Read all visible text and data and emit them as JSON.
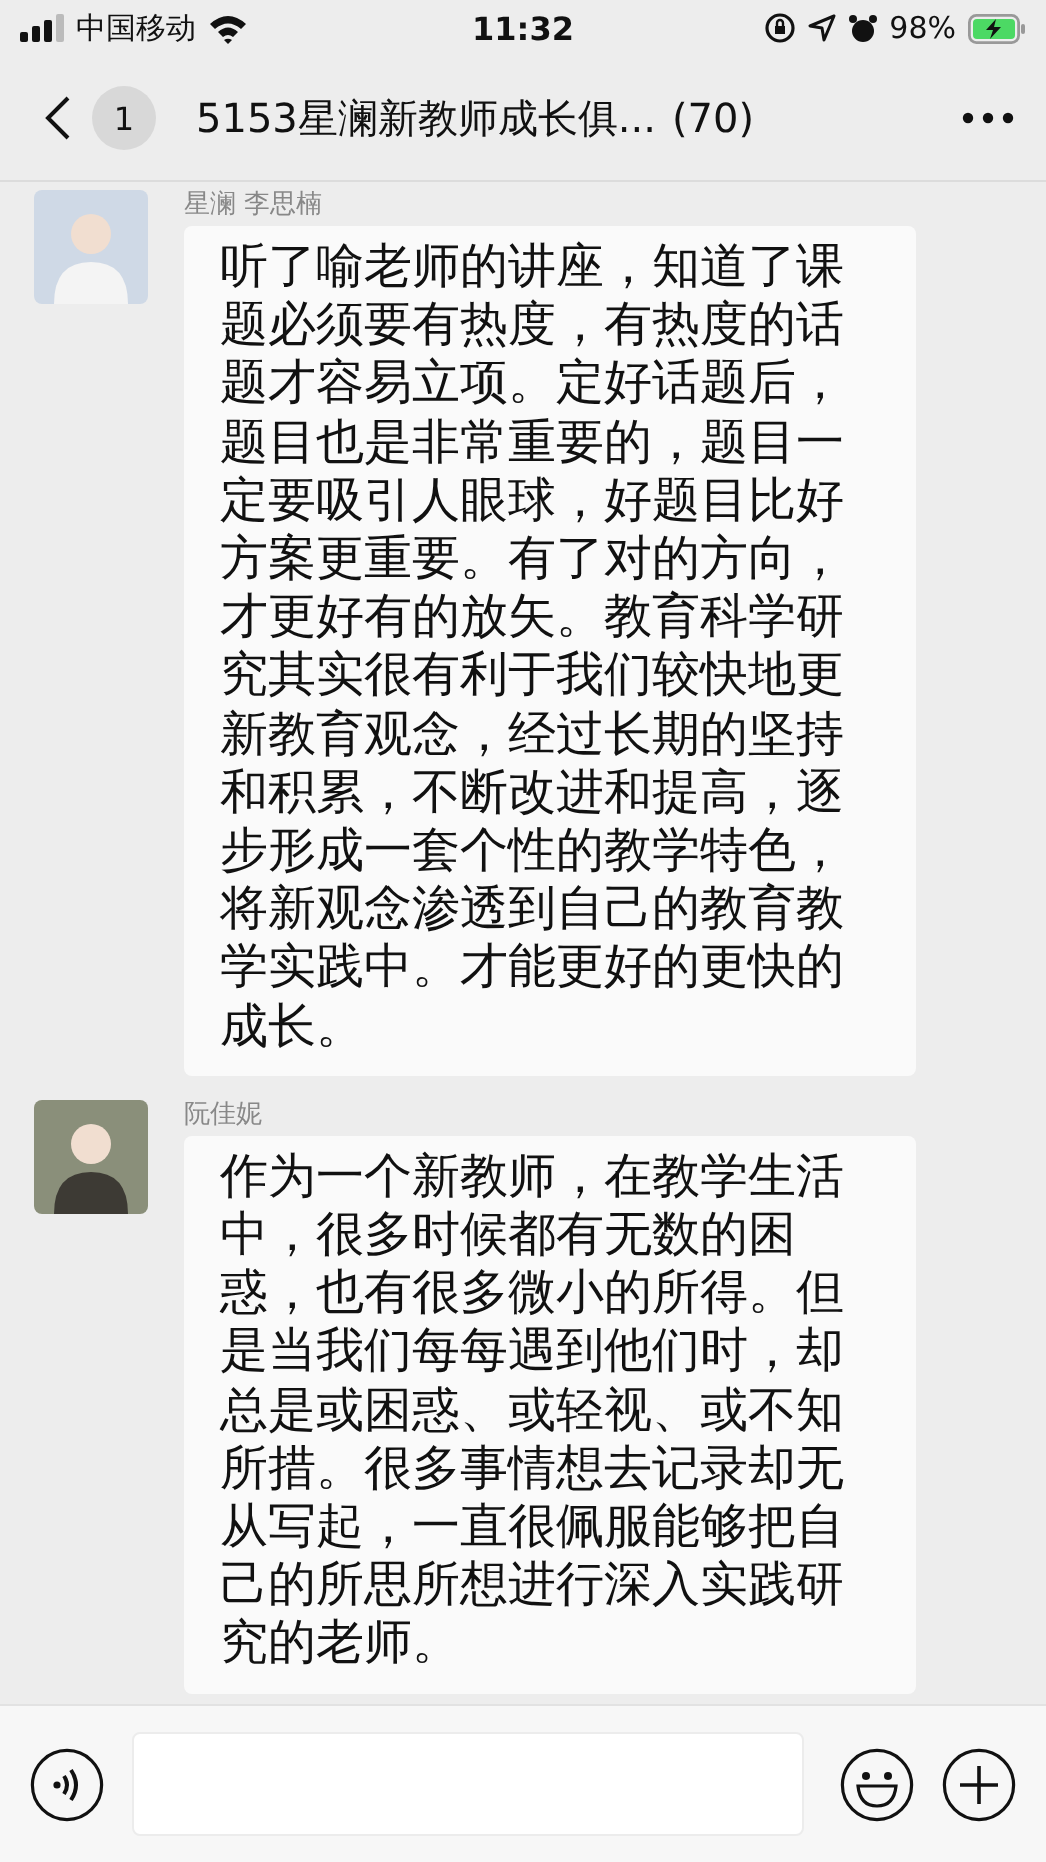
{
  "status_bar": {
    "carrier": "中国移动",
    "time": "11:32",
    "battery": "98%"
  },
  "nav": {
    "back_count": "1",
    "title": "5153星澜新教师成长俱...",
    "member_count": "(70)"
  },
  "messages": [
    {
      "sender": "星澜 李思楠",
      "text": "听了喻老师的讲座，知道了课题必须要有热度，有热度的话题才容易立项。定好话题后，题目也是非常重要的，题目一定要吸引人眼球，好题目比好方案更重要。有了对的方向，才更好有的放矢。教育科学研究其实很有利于我们较快地更新教育观念，经过长期的坚持和积累，不断改进和提高，逐步形成一套个性的教学特色，将新观念渗透到自己的教育教学实践中。才能更好的更快的成长。"
    },
    {
      "sender": "阮佳妮",
      "text": "作为一个新教师，在教学生活中，很多时候都有无数的困惑，也有很多微小的所得。但是当我们每每遇到他们时，却总是或困惑、或轻视、或不知所措。很多事情想去记录却无从写起，一直很佩服能够把自己的所思所想进行深入实践研究的老师。"
    }
  ]
}
